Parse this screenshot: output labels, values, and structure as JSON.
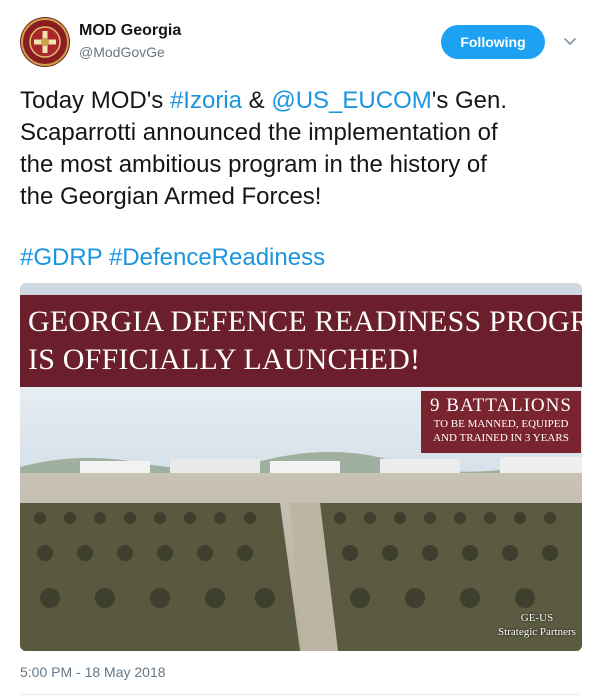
{
  "account": {
    "name": "MOD Georgia",
    "handle": "@ModGovGe"
  },
  "follow_button": {
    "label": "Following"
  },
  "tweet": {
    "line1_pre": "Today MOD's ",
    "mention1": "#Izoria",
    "line1_mid": " & ",
    "mention2": "@US_EUCOM",
    "line1_post": "'s Gen.",
    "line2": "Scaparrotti announced the implementation of",
    "line3": "the most ambitious program in the history of",
    "line4": "the Georgian Armed Forces!",
    "hashtag1": "#GDRP",
    "hashtag2": "#DefenceReadiness"
  },
  "media": {
    "banner_line1": "GEORGIA DEFENCE READINESS PROGRAM",
    "banner_line2": "IS OFFICIALLY LAUNCHED!",
    "box_big": "9 BATTALIONS",
    "box_small1": "TO BE MANNED, EQUIPED",
    "box_small2": "AND TRAINED IN 3 YEARS",
    "partners_line1": "GE-US",
    "partners_line2": "Strategic Partners"
  },
  "timestamp": "5:00 PM - 18 May 2018",
  "colors": {
    "link": "#1b95e0",
    "follow": "#1da1f2",
    "banner": "#6b1f2c"
  }
}
